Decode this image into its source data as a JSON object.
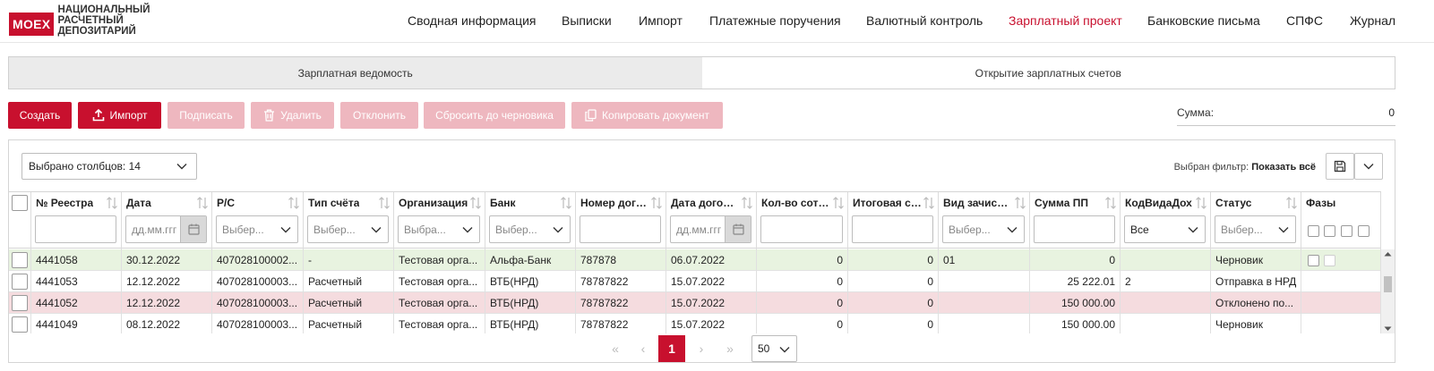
{
  "logo": {
    "box": "MOEX",
    "lines": [
      "НАЦИОНАЛЬНЫЙ",
      "РАСЧЕТНЫЙ",
      "ДЕПОЗИТАРИЙ"
    ]
  },
  "nav": [
    {
      "label": "Сводная информация"
    },
    {
      "label": "Выписки"
    },
    {
      "label": "Импорт"
    },
    {
      "label": "Платежные поручения"
    },
    {
      "label": "Валютный контроль"
    },
    {
      "label": "Зарплатный проект",
      "active": true
    },
    {
      "label": "Банковские письма"
    },
    {
      "label": "СПФС"
    },
    {
      "label": "Журнал"
    }
  ],
  "tabs": [
    {
      "label": "Зарплатная ведомость",
      "active": true
    },
    {
      "label": "Открытие зарплатных счетов"
    }
  ],
  "toolbar": {
    "create": "Создать",
    "import": "Импорт",
    "sign": "Подписать",
    "delete": "Удалить",
    "reject": "Отклонить",
    "reset_draft": "Сбросить до черновика",
    "copy_doc": "Копировать документ",
    "sum_label": "Сумма:",
    "sum_value": "0"
  },
  "grid": {
    "columns_selected": "Выбрано столбцов: 14",
    "filter_label": "Выбран фильтр:",
    "filter_value": "Показать всё",
    "columns": [
      {
        "title": "№ Реестра"
      },
      {
        "title": "Дата",
        "placeholder": "дд.мм.ггг"
      },
      {
        "title": "Р/С",
        "placeholder": "Выбер..."
      },
      {
        "title": "Тип счёта",
        "placeholder": "Выбер..."
      },
      {
        "title": "Организация",
        "placeholder": "Выбра..."
      },
      {
        "title": "Банк",
        "placeholder": "Выбер..."
      },
      {
        "title": "Номер догов..."
      },
      {
        "title": "Дата договора",
        "placeholder": "дд.мм.ггг"
      },
      {
        "title": "Кол-во сотру..."
      },
      {
        "title": "Итоговая сум..."
      },
      {
        "title": "Вид зачислен...",
        "placeholder": "Выбер..."
      },
      {
        "title": "Сумма ПП"
      },
      {
        "title": "КодВидаДох",
        "value": "Все"
      },
      {
        "title": "Статус",
        "placeholder": "Выбер..."
      },
      {
        "title": "Фазы"
      }
    ],
    "rows": [
      {
        "tone": "green",
        "cells": [
          "4441058",
          "30.12.2022",
          "407028100002...",
          "-",
          "Тестовая орга...",
          "Альфа-Банк",
          "787878",
          "06.07.2022",
          "0",
          "0",
          "01",
          "0",
          "",
          "Черновик"
        ]
      },
      {
        "tone": "white",
        "cells": [
          "4441053",
          "12.12.2022",
          "407028100003...",
          "Расчетный",
          "Тестовая орга...",
          "ВТБ(НРД)",
          "78787822",
          "15.07.2022",
          "0",
          "0",
          "",
          "25 222.01",
          "2",
          "Отправка в НРД"
        ]
      },
      {
        "tone": "pink",
        "cells": [
          "4441052",
          "12.12.2022",
          "407028100003...",
          "Расчетный",
          "Тестовая орга...",
          "ВТБ(НРД)",
          "78787822",
          "15.07.2022",
          "0",
          "0",
          "",
          "150 000.00",
          "",
          "Отклонено по..."
        ]
      },
      {
        "tone": "white",
        "cells": [
          "4441049",
          "08.12.2022",
          "407028100003...",
          "Расчетный",
          "Тестовая орга...",
          "ВТБ(НРД)",
          "78787822",
          "15.07.2022",
          "0",
          "0",
          "",
          "150 000.00",
          "",
          "Черновик"
        ]
      }
    ]
  },
  "pager": {
    "first": "«",
    "prev": "‹",
    "current": "1",
    "next": "›",
    "last": "»",
    "page_size": "50"
  },
  "colors": {
    "accent": "#c8102e",
    "disabled": "#eeb7bf",
    "row_green": "#e8f3e0",
    "row_pink": "#f5dcdf"
  }
}
